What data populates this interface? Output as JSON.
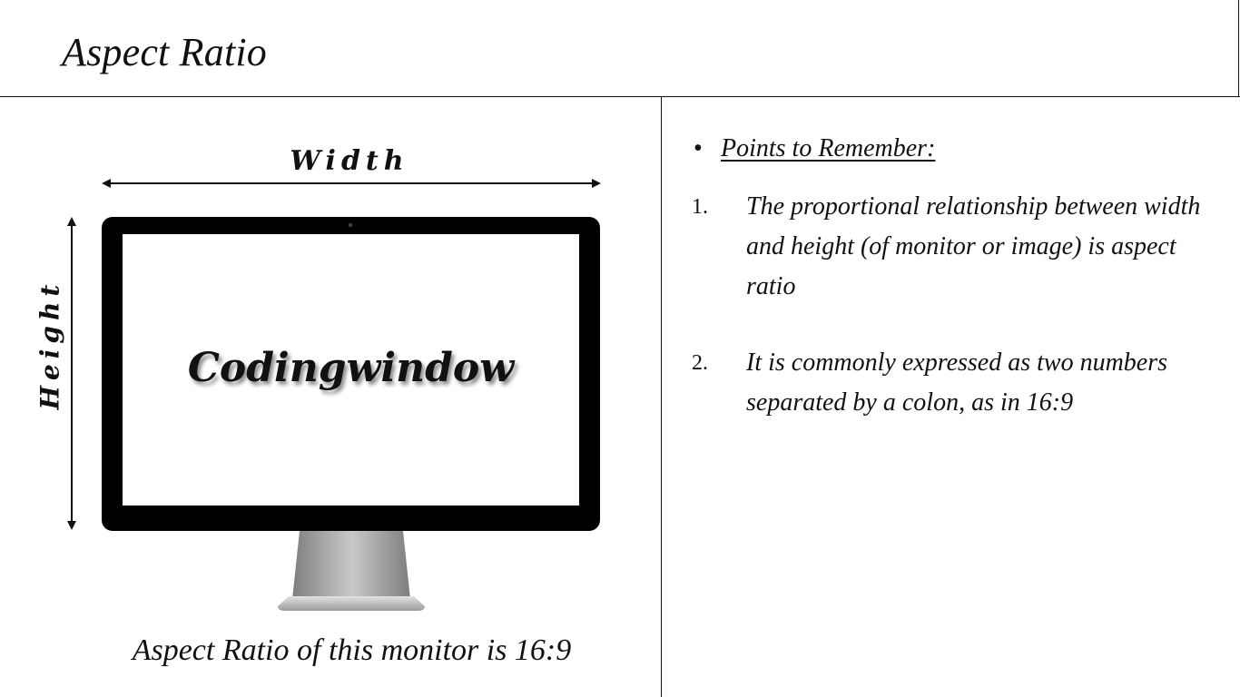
{
  "slide": {
    "title": "Aspect Ratio"
  },
  "diagram": {
    "width_label": "Width",
    "height_label": "Height",
    "brand_text": "Codingwindow",
    "caption": "Aspect Ratio of this monitor is 16:9"
  },
  "notes": {
    "bullet": "•",
    "heading": "Points to Remember:",
    "points": [
      {
        "number": "1.",
        "text": "The proportional relationship between width and height (of monitor or image) is aspect ratio"
      },
      {
        "number": "2.",
        "text": "It is commonly expressed as two numbers separated by a colon, as in 16:9"
      }
    ]
  },
  "icons": {
    "monitor": "monitor-icon",
    "width_arrow": "double-arrow-horizontal-icon",
    "height_arrow": "double-arrow-vertical-icon"
  },
  "colors": {
    "background": "#ffffff",
    "text": "#111111",
    "monitor_bezel": "#000000",
    "monitor_stand": "#9a9a9a"
  }
}
